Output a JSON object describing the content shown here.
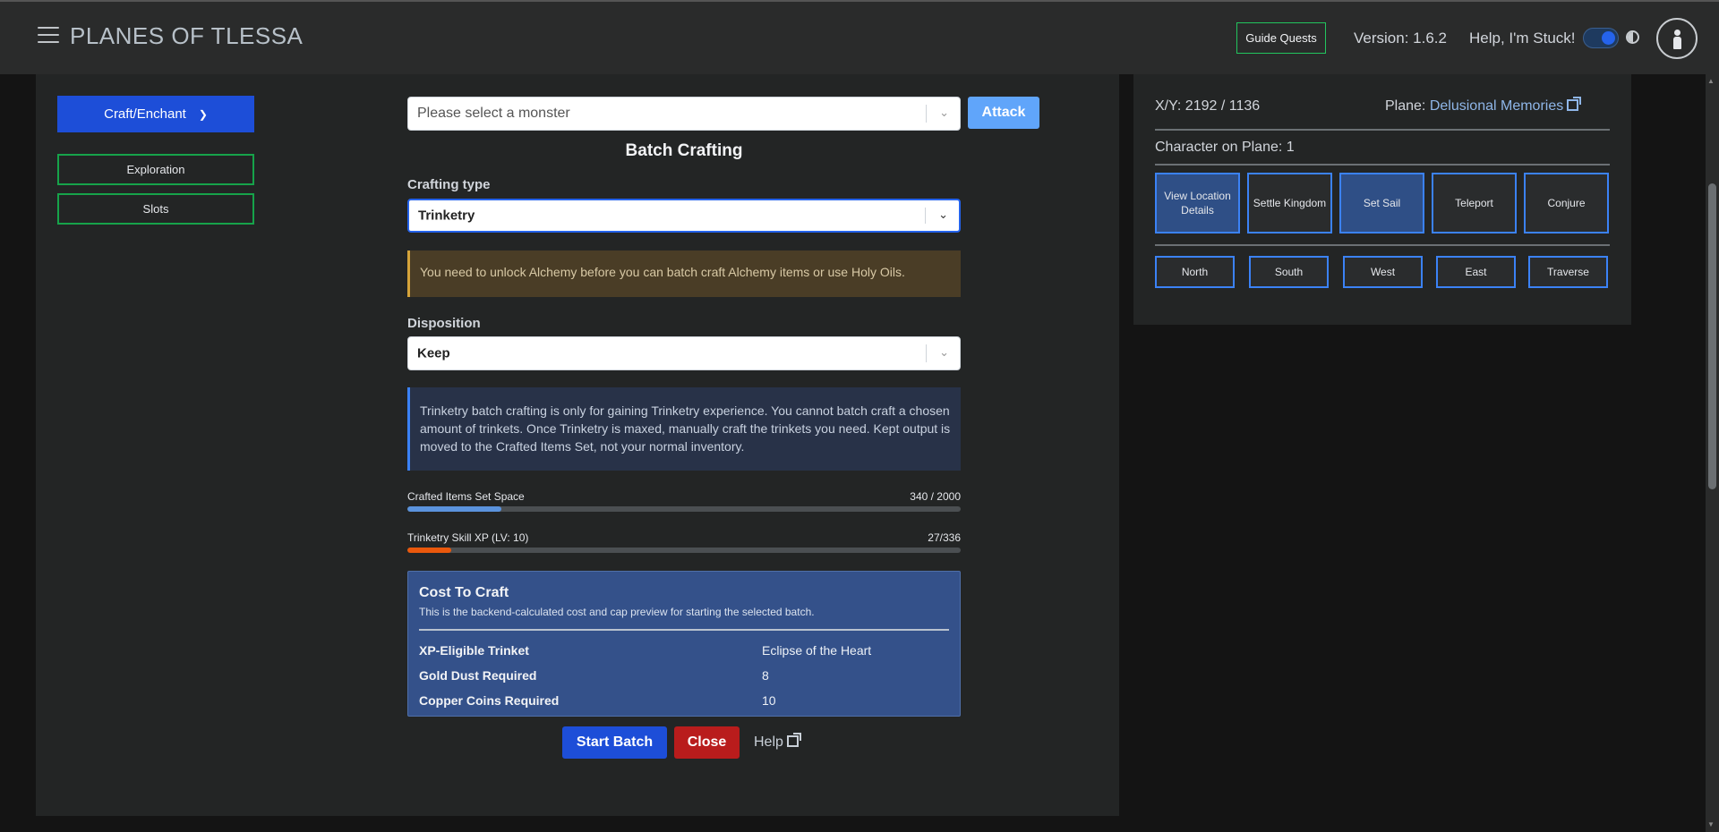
{
  "header": {
    "title": "PLANES OF TLESSA",
    "guide_quests": "Guide Quests",
    "version": "Version: 1.6.2",
    "help_stuck": "Help, I'm Stuck!"
  },
  "sidebar": {
    "craft_enchant": "Craft/Enchant",
    "exploration": "Exploration",
    "slots": "Slots"
  },
  "combat": {
    "monster_placeholder": "Please select a monster",
    "attack": "Attack"
  },
  "batch": {
    "title": "Batch Crafting",
    "crafting_type_label": "Crafting type",
    "crafting_type_value": "Trinketry",
    "alchemy_warning": "You need to unlock Alchemy before you can batch craft Alchemy items or use Holy Oils.",
    "disposition_label": "Disposition",
    "disposition_value": "Keep",
    "info": "Trinketry batch crafting is only for gaining Trinketry experience. You cannot batch craft a chosen amount of trinkets. Once Trinketry is maxed, manually craft the trinkets you need. Kept output is moved to the Crafted Items Set, not your normal inventory.",
    "set_space_label": "Crafted Items Set Space",
    "set_space_value": "340 / 2000",
    "set_space_fraction": 0.17,
    "xp_label": "Trinketry Skill XP (LV: 10)",
    "xp_value": "27/336",
    "xp_fraction": 0.08,
    "cost": {
      "title": "Cost To Craft",
      "subtitle": "This is the backend-calculated cost and cap preview for starting the selected batch.",
      "rows": [
        {
          "key": "XP-Eligible Trinket",
          "value": "Eclipse of the Heart"
        },
        {
          "key": "Gold Dust Required",
          "value": "8"
        },
        {
          "key": "Copper Coins Required",
          "value": "10"
        }
      ]
    },
    "start_batch": "Start Batch",
    "close": "Close",
    "help": "Help"
  },
  "map": {
    "coords": "X/Y: 2192 / 1136",
    "plane_prefix": "Plane:",
    "plane_name": "Delusional Memories",
    "characters_on_plane": "Character on Plane: 1",
    "actions": [
      "View Location Details",
      "Settle Kingdom",
      "Set Sail",
      "Teleport",
      "Conjure"
    ],
    "directions": [
      "North",
      "South",
      "West",
      "East",
      "Traverse"
    ]
  },
  "icons": {
    "menu": "hamburger-menu-icon",
    "chevron": "chevron-down-icon",
    "external": "external-link-icon",
    "contrast": "contrast-icon",
    "user": "user-icon"
  },
  "colors": {
    "primary": "#1d4ed8",
    "success_border": "#16a34a",
    "danger": "#b91c1c",
    "attack": "#60a5fa",
    "xp_bar": "#ea580c",
    "space_bar": "#5b93dd",
    "action_border": "#3b82f6"
  }
}
